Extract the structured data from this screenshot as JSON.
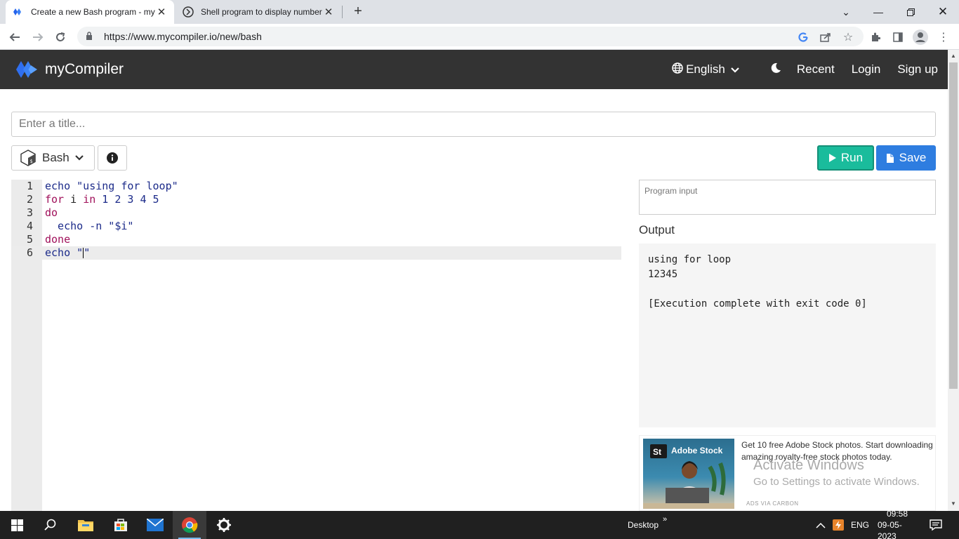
{
  "browser": {
    "tabs": [
      {
        "title": "Create a new Bash program - my",
        "active": true
      },
      {
        "title": "Shell program to display number",
        "active": false
      }
    ],
    "url": "https://www.mycompiler.io/new/bash"
  },
  "site": {
    "brand": "myCompiler",
    "nav": {
      "language": "English",
      "recent": "Recent",
      "login": "Login",
      "signup": "Sign up"
    }
  },
  "editor_page": {
    "title_placeholder": "Enter a title...",
    "language": "Bash",
    "run_label": "Run",
    "save_label": "Save",
    "line_numbers": [
      "1",
      "2",
      "3",
      "4",
      "5",
      "6"
    ],
    "program_input_placeholder": "Program input",
    "output_label": "Output",
    "output_text": "using for loop\n12345\n\n[Execution complete with exit code 0]"
  },
  "ad": {
    "brand": "Adobe Stock",
    "text": "Get 10 free Adobe Stock photos. Start downloading amazing royalty-free stock photos today.",
    "via": "ADS VIA CARBON"
  },
  "watermark": {
    "line1": "Activate Windows",
    "line2": "Go to Settings to activate Windows."
  },
  "taskbar": {
    "desktop_label": "Desktop",
    "lang": "ENG",
    "time": "09:58",
    "date": "09-05-2023"
  },
  "colors": {
    "header_bg": "#333333",
    "run_green": "#1abc9c",
    "save_blue": "#2e7de0",
    "keyword": "#a0105a",
    "code_text": "#1c2b8a"
  }
}
